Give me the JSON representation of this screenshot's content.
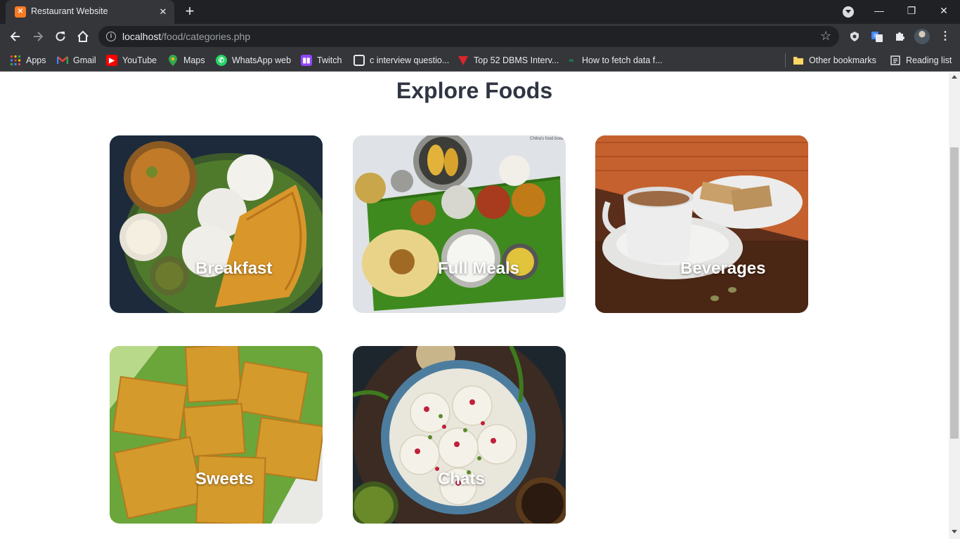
{
  "browser": {
    "tab": {
      "title": "Restaurant Website",
      "favicon": "xampp-icon"
    },
    "new_tab_label": "+",
    "omnibox": {
      "host": "localhost",
      "path": "/food/categories.php"
    }
  },
  "bookmarks": {
    "items": [
      {
        "label": "Apps",
        "icon": "apps-grid-icon"
      },
      {
        "label": "Gmail",
        "icon": "gmail-icon"
      },
      {
        "label": "YouTube",
        "icon": "youtube-icon"
      },
      {
        "label": "Maps",
        "icon": "maps-icon"
      },
      {
        "label": "WhatsApp web",
        "icon": "whatsapp-icon"
      },
      {
        "label": "Twitch",
        "icon": "twitch-icon"
      },
      {
        "label": "c interview questio...",
        "icon": "page-icon"
      },
      {
        "label": "Top 52 DBMS Interv...",
        "icon": "guru99-icon"
      },
      {
        "label": "How to fetch data f...",
        "icon": "link-icon"
      }
    ],
    "other_bookmarks": "Other bookmarks",
    "reading_list": "Reading list"
  },
  "page": {
    "title": "Explore Foods",
    "categories": [
      {
        "label": "Breakfast"
      },
      {
        "label": "Full Meals"
      },
      {
        "label": "Beverages"
      },
      {
        "label": "Sweets"
      },
      {
        "label": "Chats"
      }
    ]
  },
  "colors": {
    "title_text": "#2f3542",
    "chrome_dark": "#202124",
    "chrome_toolbar": "#35363a",
    "card_label": "#ffffff"
  }
}
